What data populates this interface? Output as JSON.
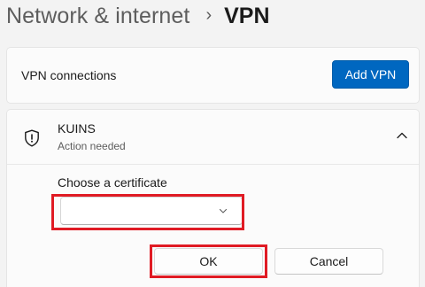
{
  "breadcrumb": {
    "parent": "Network & internet",
    "separator": "›",
    "current": "VPN"
  },
  "connections": {
    "label": "VPN connections",
    "add_button": "Add VPN"
  },
  "vpn": {
    "name": "KUINS",
    "status": "Action needed",
    "icon": "shield-icon",
    "expanded": true,
    "certificate": {
      "label": "Choose a certificate",
      "selected_value": ""
    },
    "ok_button": "OK",
    "cancel_button": "Cancel"
  },
  "colors": {
    "accent": "#0067c0",
    "highlight": "#e01b24",
    "background": "#f3f3f3"
  }
}
